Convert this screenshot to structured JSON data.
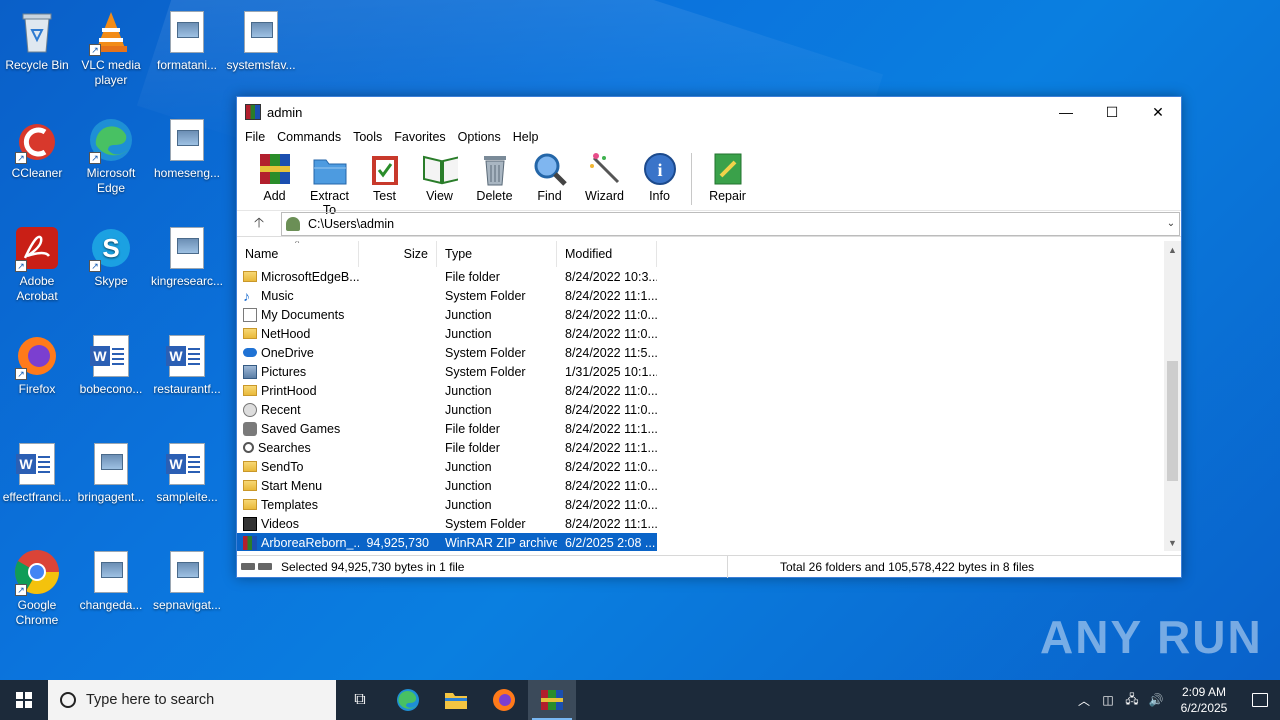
{
  "desktop": {
    "icons": [
      {
        "label": "Recycle Bin"
      },
      {
        "label": "VLC media player"
      },
      {
        "label": "formatani..."
      },
      {
        "label": "systemsfav..."
      },
      {
        "label": "CCleaner"
      },
      {
        "label": "Microsoft Edge"
      },
      {
        "label": "homeseng..."
      },
      {
        "label": "Adobe Acrobat"
      },
      {
        "label": "Skype"
      },
      {
        "label": "kingresearc..."
      },
      {
        "label": "Firefox"
      },
      {
        "label": "bobecono..."
      },
      {
        "label": "restaurantf..."
      },
      {
        "label": "effectfranci..."
      },
      {
        "label": "bringagent..."
      },
      {
        "label": "sampleite..."
      },
      {
        "label": "Google Chrome"
      },
      {
        "label": "changeda..."
      },
      {
        "label": "sepnavigat..."
      }
    ],
    "watermark": "ANY RUN"
  },
  "window": {
    "title": "admin",
    "menu": [
      "File",
      "Commands",
      "Tools",
      "Favorites",
      "Options",
      "Help"
    ],
    "toolbar": [
      "Add",
      "Extract To",
      "Test",
      "View",
      "Delete",
      "Find",
      "Wizard",
      "Info",
      "Repair"
    ],
    "address": "C:\\Users\\admin",
    "columns": {
      "name": "Name",
      "size": "Size",
      "type": "Type",
      "modified": "Modified"
    },
    "files": [
      {
        "name": "MicrosoftEdgeB...",
        "size": "",
        "type": "File folder",
        "modified": "8/24/2022 10:3..."
      },
      {
        "name": "Music",
        "size": "",
        "type": "System Folder",
        "modified": "8/24/2022 11:1..."
      },
      {
        "name": "My Documents",
        "size": "",
        "type": "Junction",
        "modified": "8/24/2022 11:0..."
      },
      {
        "name": "NetHood",
        "size": "",
        "type": "Junction",
        "modified": "8/24/2022 11:0..."
      },
      {
        "name": "OneDrive",
        "size": "",
        "type": "System Folder",
        "modified": "8/24/2022 11:5..."
      },
      {
        "name": "Pictures",
        "size": "",
        "type": "System Folder",
        "modified": "1/31/2025 10:1..."
      },
      {
        "name": "PrintHood",
        "size": "",
        "type": "Junction",
        "modified": "8/24/2022 11:0..."
      },
      {
        "name": "Recent",
        "size": "",
        "type": "Junction",
        "modified": "8/24/2022 11:0..."
      },
      {
        "name": "Saved Games",
        "size": "",
        "type": "File folder",
        "modified": "8/24/2022 11:1..."
      },
      {
        "name": "Searches",
        "size": "",
        "type": "File folder",
        "modified": "8/24/2022 11:1..."
      },
      {
        "name": "SendTo",
        "size": "",
        "type": "Junction",
        "modified": "8/24/2022 11:0..."
      },
      {
        "name": "Start Menu",
        "size": "",
        "type": "Junction",
        "modified": "8/24/2022 11:0..."
      },
      {
        "name": "Templates",
        "size": "",
        "type": "Junction",
        "modified": "8/24/2022 11:0..."
      },
      {
        "name": "Videos",
        "size": "",
        "type": "System Folder",
        "modified": "8/24/2022 11:1..."
      },
      {
        "name": "ArboreaReborn_...",
        "size": "94,925,730",
        "type": "WinRAR ZIP archive",
        "modified": "6/2/2025 2:08 ..."
      }
    ],
    "status_left": "Selected 94,925,730 bytes in 1 file",
    "status_right": "Total 26 folders and 105,578,422 bytes in 8 files"
  },
  "taskbar": {
    "search_placeholder": "Type here to search",
    "time": "2:09 AM",
    "date": "6/2/2025"
  }
}
